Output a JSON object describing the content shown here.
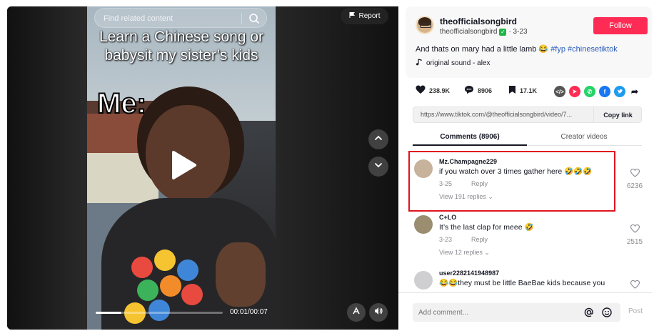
{
  "video": {
    "search_placeholder": "Find related content",
    "report_label": "Report",
    "overlay_caption": "Learn a Chinese song or babysit my sister’s kids",
    "overlay_me": "Me:",
    "time": "00:01/00:07",
    "progress": 0.2
  },
  "author": {
    "display_name": "theofficialsongbird",
    "username": "theofficialsongbird",
    "date": "· 3-23",
    "follow_label": "Follow",
    "caption_text": "And thats on mary had a little lamb 😂 ",
    "caption_tags": "#fyp #chinesetiktok",
    "sound": "original sound - alex"
  },
  "actions": {
    "likes": "238.9K",
    "comments": "8906",
    "saves": "17.1K"
  },
  "link": {
    "url": "https://www.tiktok.com/@theofficialsongbird/video/7...",
    "copy_label": "Copy link"
  },
  "tabs": {
    "comments": "Comments (8906)",
    "creator_videos": "Creator videos"
  },
  "comments": [
    {
      "user": "Mz.Champagne229",
      "text": "if you watch over 3 times gather here 🤣🤣🤣",
      "date": "3-25",
      "reply": "Reply",
      "view_replies": "View 191 replies ⌄",
      "likes": "6236"
    },
    {
      "user": "C+LO",
      "text": "It’s the last clap for meee 🤣",
      "date": "3-23",
      "reply": "Reply",
      "view_replies": "View 12 replies ⌄",
      "likes": "2515"
    },
    {
      "user": "user2282141948987",
      "text": "😂😂they must be little BaeBae kids because you",
      "date": "",
      "reply": "",
      "view_replies": "",
      "likes": ""
    }
  ],
  "add_comment": {
    "placeholder": "Add comment...",
    "post_label": "Post"
  },
  "colors": {
    "follow": "#fe2c55",
    "highlight": "#e0141e",
    "tag": "#2b5db9"
  }
}
